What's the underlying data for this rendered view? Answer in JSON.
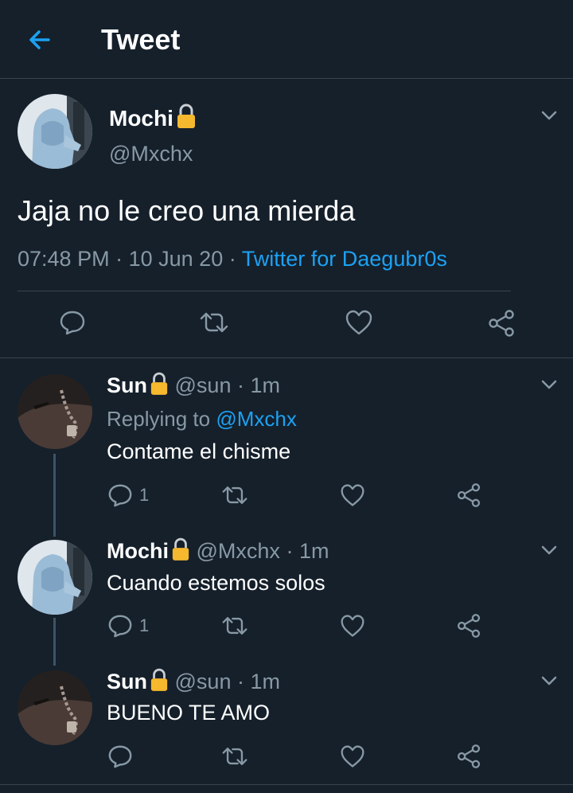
{
  "header": {
    "title": "Tweet"
  },
  "main_tweet": {
    "name": "Mochi",
    "handle": "@Mxchx",
    "text": "Jaja no le creo una mierda",
    "time": "07:48 PM",
    "date": "10 Jun 20",
    "separator": "·",
    "source": "Twitter for Daegubr0s"
  },
  "replies": [
    {
      "name": "Sun",
      "handle": "@sun",
      "time": "1m",
      "separator": "·",
      "replying_prefix": "Replying to",
      "replying_to": "@Mxchx",
      "text": "Contame el chisme",
      "reply_count": "1"
    },
    {
      "name": "Mochi",
      "handle": "@Mxchx",
      "time": "1m",
      "separator": "·",
      "text": "Cuando estemos solos",
      "reply_count": "1"
    },
    {
      "name": "Sun",
      "handle": "@sun",
      "time": "1m",
      "separator": "·",
      "text": "BUENO TE AMO",
      "reply_count": ""
    }
  ],
  "icons": {
    "back": "arrow-left-icon",
    "caret": "chevron-down-icon",
    "lock": "lock-icon",
    "reply": "comment-icon",
    "retweet": "retweet-icon",
    "like": "heart-icon",
    "share": "share-icon"
  },
  "colors": {
    "background": "#15202b",
    "accent": "#1da1f2",
    "secondary_text": "#8899a6",
    "divider": "#38444d",
    "lock": "#f5b82e"
  }
}
